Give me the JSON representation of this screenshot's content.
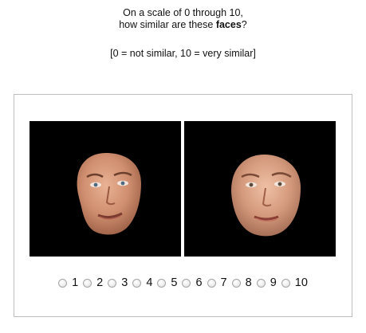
{
  "question": {
    "line1": "On a scale of 0 through 10,",
    "line2_prefix": "how similar are these ",
    "line2_bold": "faces",
    "line2_suffix": "?"
  },
  "scale_note": "[0 = not similar, 10 = very similar]",
  "rating": {
    "options": [
      "1",
      "2",
      "3",
      "4",
      "5",
      "6",
      "7",
      "8",
      "9",
      "10"
    ],
    "selected": null
  },
  "images": {
    "left": "face-image-male",
    "right": "face-image-female"
  }
}
